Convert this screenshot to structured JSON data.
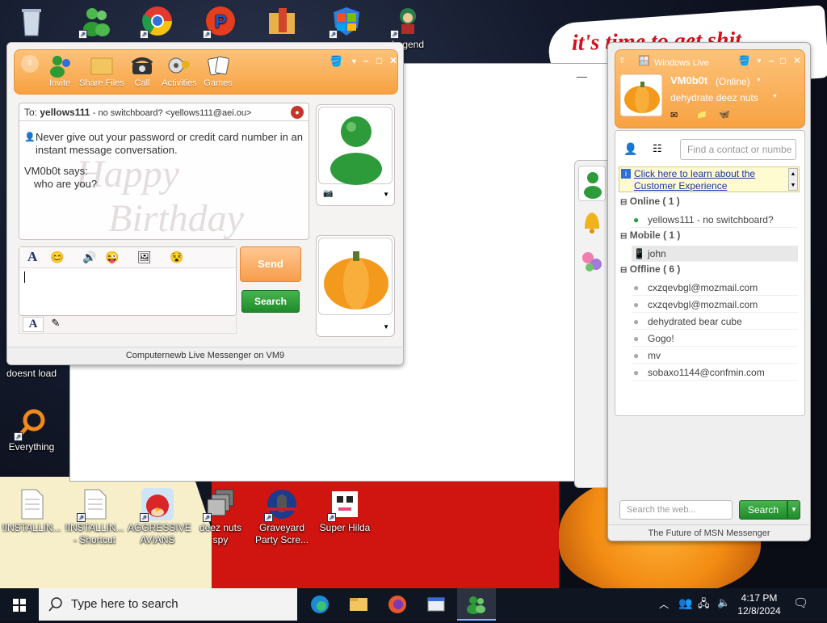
{
  "desktop": {
    "wallpaper_text": "it's time to get shit",
    "icons": [
      {
        "label": "",
        "icon": "recycle-bin-icon"
      },
      {
        "label": "",
        "icon": "messenger-icon"
      },
      {
        "label": "",
        "icon": "chrome-icon"
      },
      {
        "label": "",
        "icon": "parsec-icon"
      },
      {
        "label": "",
        "icon": "folder-icon"
      },
      {
        "label": "",
        "icon": "windows-security-icon"
      },
      {
        "label": "Legend",
        "icon": "game-character-icon"
      },
      {
        "label": "doesnt load",
        "icon": "app-icon"
      },
      {
        "label": "Everything",
        "icon": "everything-search-icon"
      },
      {
        "label": "!INSTALLIN...",
        "icon": "document-icon"
      },
      {
        "label": "!INSTALLIN... - Shortcut",
        "icon": "document-shortcut-icon"
      },
      {
        "label": "AGGRESSIVE AVIANS",
        "icon": "angry-bird-icon"
      },
      {
        "label": "deez nuts spy",
        "icon": "stacked-windows-icon"
      },
      {
        "label": "Graveyard Party Scre...",
        "icon": "graveyard-icon"
      },
      {
        "label": "Super Hilda",
        "icon": "pixel-character-icon"
      }
    ]
  },
  "conversation": {
    "toolbar": [
      {
        "label": "Invite",
        "icon": "invite-icon"
      },
      {
        "label": "Share Files",
        "icon": "folder-icon"
      },
      {
        "label": "Call",
        "icon": "phone-icon"
      },
      {
        "label": "Activities",
        "icon": "activities-icon"
      },
      {
        "label": "Games",
        "icon": "games-icon"
      }
    ],
    "to_label": "To:",
    "to_name": "yellows111",
    "to_detail": "- no switchboard? <yellows111@aei.ou>",
    "messages": {
      "warning": "Never give out your password or credit card number in an instant message conversation.",
      "sender": "VM0b0t says:",
      "text": "who are you?"
    },
    "background_text": {
      "line1": "Happy",
      "line2": "Birthday"
    },
    "input_value": "",
    "send_label": "Send",
    "search_label": "Search",
    "status_bar": "Computernewb Live Messenger on VM9"
  },
  "contact_list": {
    "brand": "Windows Live",
    "user_name": "VM0b0t",
    "user_status": "(Online)",
    "personal_message": "dehydrate deez nuts",
    "search_placeholder": "Find a contact or numbe",
    "info_link": "Click here to learn about the Customer Experience",
    "groups": [
      {
        "label": "Online ( 1 )",
        "contacts": [
          {
            "name": "yellows111 - no switchboard?",
            "status": "online"
          }
        ]
      },
      {
        "label": "Mobile ( 1 )",
        "contacts": [
          {
            "name": "john",
            "status": "mobile"
          }
        ]
      },
      {
        "label": "Offline ( 6 )",
        "contacts": [
          {
            "name": "cxzqevbgl@mozmail.com",
            "status": "offline"
          },
          {
            "name": "cxzqevbgl@mozmail.com",
            "status": "offline"
          },
          {
            "name": "dehydrated bear cube",
            "status": "offline"
          },
          {
            "name": "Gogo!",
            "status": "offline"
          },
          {
            "name": "mv",
            "status": "offline"
          },
          {
            "name": "sobaxo1144@confmin.com",
            "status": "offline"
          }
        ]
      }
    ],
    "web_search_placeholder": "Search the web...",
    "web_search_button": "Search",
    "footer": "The Future of MSN Messenger"
  },
  "taskbar": {
    "search_placeholder": "Type here to search",
    "time": "4:17 PM",
    "date": "12/8/2024"
  },
  "colors": {
    "toolbar_orange": "#f7a242",
    "send_orange": "#f79c4b",
    "search_green": "#1f8a2a",
    "taskbar": "#101522"
  }
}
